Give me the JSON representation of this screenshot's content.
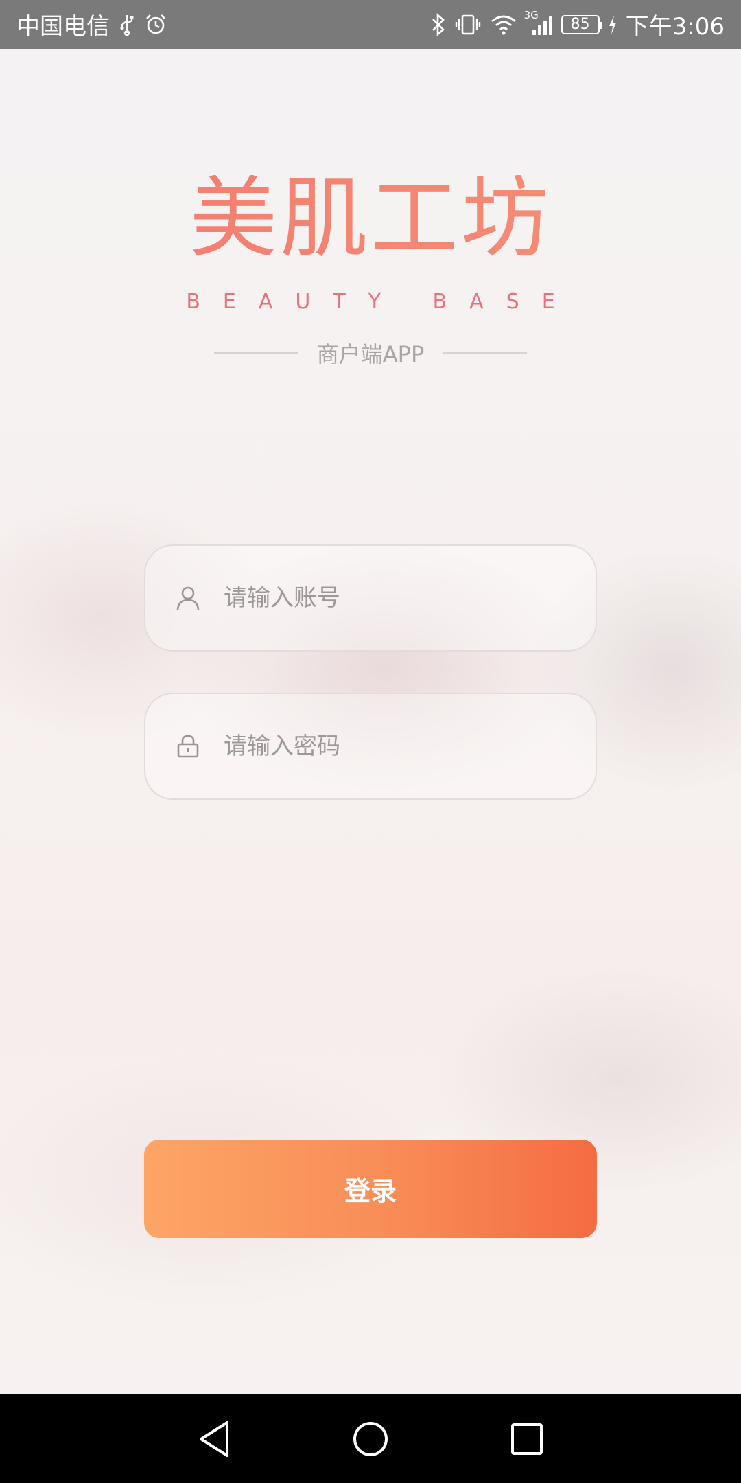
{
  "status_bar": {
    "carrier": "中国电信",
    "battery": "85",
    "time": "下午3:06",
    "network": "3G",
    "icons": [
      "usb-icon",
      "alarm-icon",
      "bluetooth-icon",
      "vibrate-icon",
      "wifi-icon",
      "signal-icon",
      "battery-icon",
      "charging-icon"
    ]
  },
  "brand": {
    "name_cn": "美肌工坊",
    "name_en": "BEAUTY BASE",
    "subtitle": "商户端APP",
    "logo_color": "#f3836d"
  },
  "form": {
    "account": {
      "placeholder": "请输入账号",
      "value": "",
      "icon": "user-icon"
    },
    "password": {
      "placeholder": "请输入密码",
      "value": "",
      "icon": "lock-icon"
    },
    "login_label": "登录",
    "login_color_start": "#fda566",
    "login_color_end": "#f56c42"
  },
  "nav_bar": {
    "icons": [
      "back-icon",
      "home-icon",
      "recents-icon"
    ]
  }
}
